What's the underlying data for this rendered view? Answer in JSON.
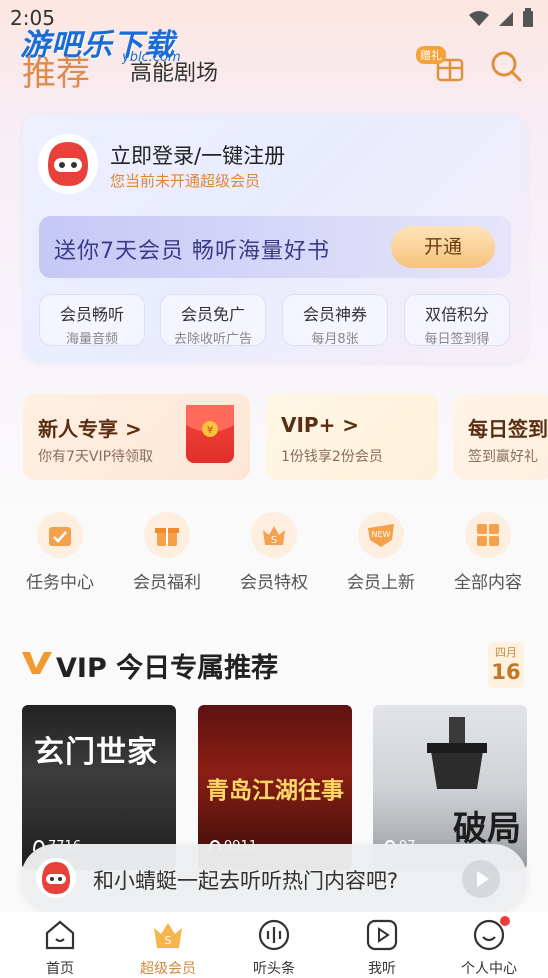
{
  "status_bar": {
    "time": "2:05"
  },
  "watermark": {
    "title": "游吧乐下载",
    "sub": "yblc.com"
  },
  "header": {
    "tab_active": "推荐",
    "tab_other": "高能剧场",
    "gift_tag": "赠礼"
  },
  "member_card": {
    "login_title": "立即登录/一键注册",
    "login_sub": "您当前未开通超级会员",
    "promo_text": "送你7天会员 畅听海量好书",
    "open_button": "开通",
    "perks": [
      {
        "title": "会员畅听",
        "sub": "海量音频"
      },
      {
        "title": "会员免广",
        "sub": "去除收听广告"
      },
      {
        "title": "会员神券",
        "sub": "每月8张"
      },
      {
        "title": "双倍积分",
        "sub": "每日签到得"
      }
    ]
  },
  "promo_strip": [
    {
      "title": "新人专享 >",
      "sub": "你有7天VIP待领取"
    },
    {
      "title": "VIP+ >",
      "sub": "1份钱享2份会员"
    },
    {
      "title": "每日签到",
      "sub": "签到赢好礼"
    }
  ],
  "quick_menu": [
    {
      "label": "任务中心",
      "icon": "calendar-check-icon"
    },
    {
      "label": "会员福利",
      "icon": "gift-box-icon"
    },
    {
      "label": "会员特权",
      "icon": "crown-s-icon"
    },
    {
      "label": "会员上新",
      "icon": "new-badge-icon"
    },
    {
      "label": "全部内容",
      "icon": "grid-icon"
    }
  ],
  "section": {
    "title": "VIP 今日专属推荐",
    "date_month": "四月",
    "date_day": "16"
  },
  "books": [
    {
      "title": "玄门世家",
      "count": "7716"
    },
    {
      "title": "青岛江湖往事",
      "count": "9911"
    },
    {
      "title": "破局",
      "count": "97"
    }
  ],
  "float_bar": {
    "text": "和小蜻蜓一起去听听热门内容吧?"
  },
  "bottom_nav": [
    {
      "label": "首页",
      "icon": "home-icon"
    },
    {
      "label": "超级会员",
      "icon": "vip-crown-icon"
    },
    {
      "label": "听头条",
      "icon": "audio-wave-icon"
    },
    {
      "label": "我听",
      "icon": "play-square-icon"
    },
    {
      "label": "个人中心",
      "icon": "smile-face-icon"
    }
  ],
  "colors": {
    "accent": "#e08a4a",
    "brand_orange": "#f6a23a",
    "promo_text": "#3c3a8a"
  }
}
